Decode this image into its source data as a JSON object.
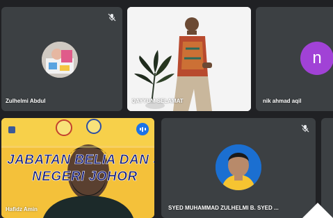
{
  "meeting": {
    "participants": [
      {
        "name": "Zulhelmi Abdul",
        "muted": true
      },
      {
        "name": "QAYYUM SELAMAT",
        "muted": false
      },
      {
        "name": "nik ahmad aqil",
        "initial": "n",
        "muted": false
      },
      {
        "name": "Hafidz Amin",
        "muted": false,
        "speaking": true
      },
      {
        "name": "SYED MUHAMMAD ZULHELMI B. SYED ...",
        "muted": true
      }
    ],
    "banner": {
      "line1": "JABATAN BELIA DAN SUKAN",
      "line2": "NEGERI JOHOR"
    }
  },
  "colors": {
    "background": "#202124",
    "tile": "#3c4043",
    "avatar_purple": "#a142d6",
    "speaking_blue": "#1a73e8"
  }
}
